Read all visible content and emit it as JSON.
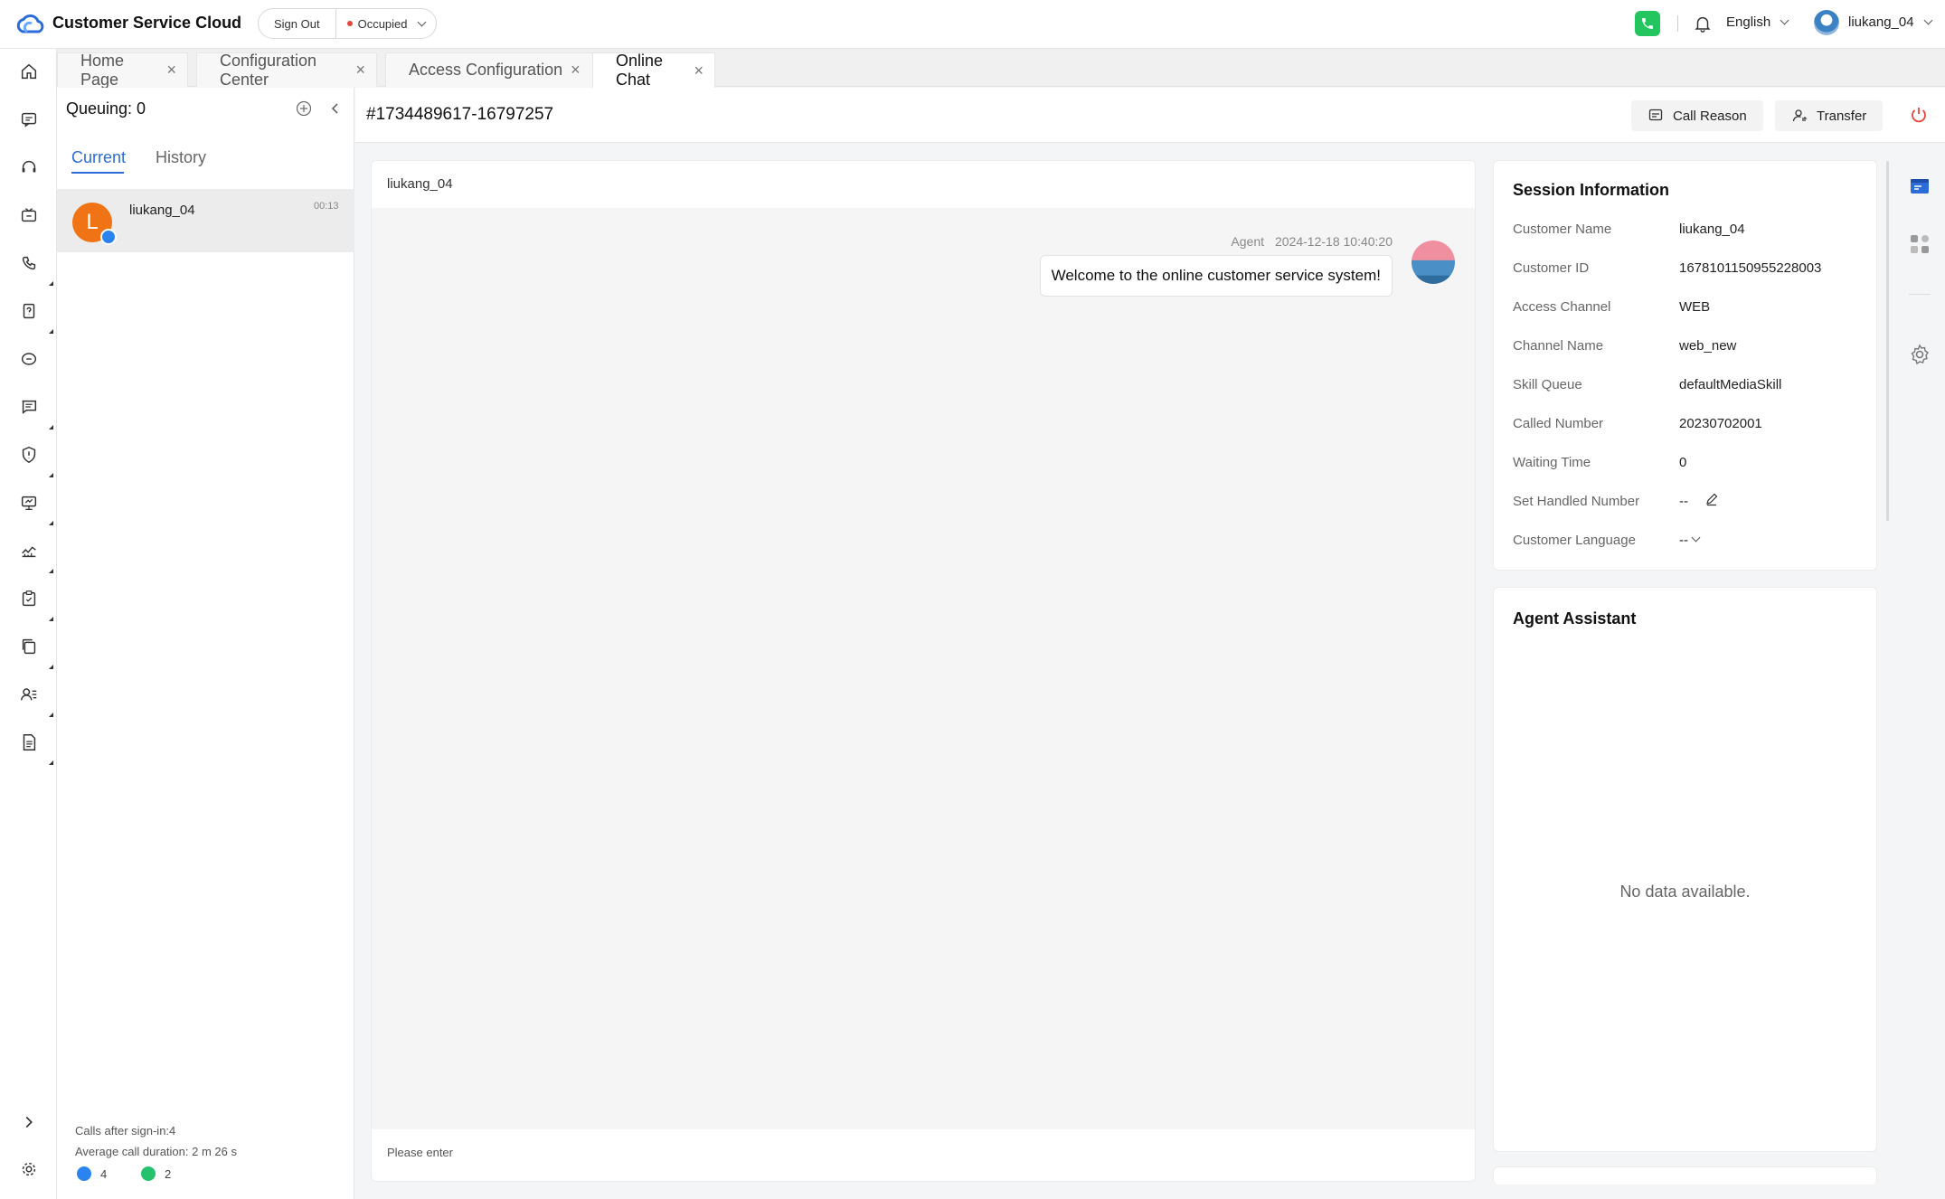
{
  "header": {
    "app_title": "Customer Service Cloud",
    "sign_out": "Sign Out",
    "status": "Occupied",
    "language": "English",
    "username": "liukang_04"
  },
  "colors": {
    "accent": "#2b6cd9",
    "status_dot": "#e8453c",
    "phone": "#22c55e",
    "avatar": "#f07316"
  },
  "tabs": [
    {
      "label": "Home Page",
      "active": false
    },
    {
      "label": "Configuration Center",
      "active": false
    },
    {
      "label": "Access Configuration",
      "active": false
    },
    {
      "label": "Online Chat",
      "active": true
    }
  ],
  "rail_icons": [
    "home-icon",
    "chat-icon",
    "headset-icon",
    "inbox-icon",
    "phone-call-icon",
    "help-doc-icon",
    "message-icon",
    "comment-icon",
    "shield-icon",
    "monitor-icon",
    "chart-icon",
    "clipboard-icon",
    "copy-icon",
    "user-list-icon",
    "document-icon",
    "expand-icon",
    "settings-icon"
  ],
  "queue": {
    "title": "Queuing: 0",
    "tab_current": "Current",
    "tab_history": "History",
    "item": {
      "initial": "L",
      "name": "liukang_04",
      "time": "00:13"
    },
    "calls_after_signin": "Calls after sign-in:4",
    "avg_duration": "Average call duration: 2 m 26 s",
    "web_count": "4",
    "whatsapp_count": "2"
  },
  "conversation": {
    "id": "#1734489617-16797257",
    "call_reason": "Call Reason",
    "transfer": "Transfer",
    "customer": "liukang_04",
    "message": {
      "sender": "Agent",
      "timestamp": "2024-12-18 10:40:20",
      "text": "Welcome to the online customer service system!"
    },
    "input_placeholder": "Please enter"
  },
  "session": {
    "title": "Session Information",
    "rows": [
      {
        "label": "Customer Name",
        "value": "liukang_04"
      },
      {
        "label": "Customer ID",
        "value": "1678101150955228003"
      },
      {
        "label": "Access Channel",
        "value": "WEB"
      },
      {
        "label": "Channel Name",
        "value": "web_new"
      },
      {
        "label": "Skill Queue",
        "value": "defaultMediaSkill"
      },
      {
        "label": "Called Number",
        "value": "20230702001"
      },
      {
        "label": "Waiting Time",
        "value": "0"
      },
      {
        "label": "Set Handled Number",
        "value": "--"
      },
      {
        "label": "Customer Language",
        "value": "--"
      }
    ]
  },
  "assistant": {
    "title": "Agent Assistant",
    "empty": "No data available."
  }
}
